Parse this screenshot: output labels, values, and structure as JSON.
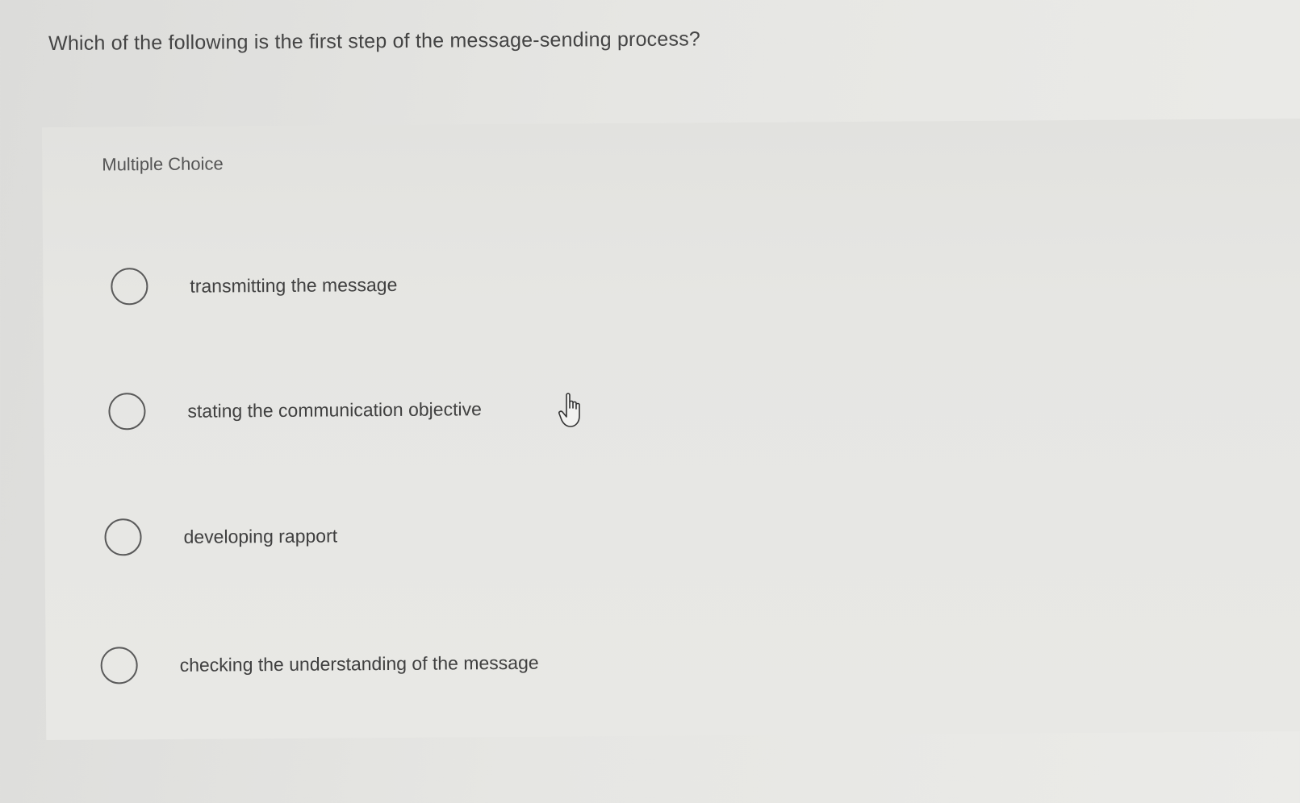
{
  "question": {
    "text": "Which of the following is the first step of the message-sending process?"
  },
  "card": {
    "label": "Multiple Choice"
  },
  "options": [
    {
      "text": "transmitting the message",
      "selected": false
    },
    {
      "text": "stating the communication objective",
      "selected": false
    },
    {
      "text": "developing rapport",
      "selected": false
    },
    {
      "text": "checking the understanding of the message",
      "selected": false
    }
  ],
  "cursor": {
    "icon": "hand-pointer-icon"
  },
  "colors": {
    "background": "#e6e6e3",
    "text": "#404040",
    "radio_border": "#5a5a5a"
  }
}
